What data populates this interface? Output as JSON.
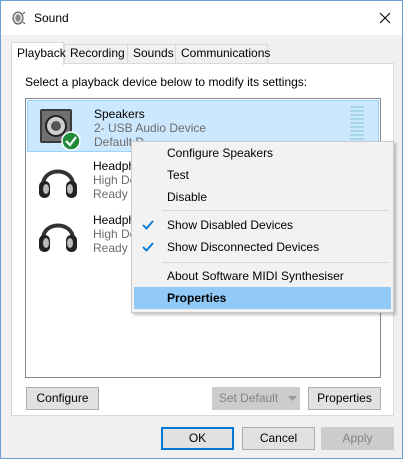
{
  "window": {
    "title": "Sound",
    "close_label": "✕"
  },
  "tabs": [
    {
      "label": "Playback",
      "active": true
    },
    {
      "label": "Recording",
      "active": false
    },
    {
      "label": "Sounds",
      "active": false
    },
    {
      "label": "Communications",
      "active": false
    }
  ],
  "instructions": "Select a playback device below to modify its settings:",
  "devices": [
    {
      "name": "Speakers",
      "description": "2- USB Audio Device",
      "status": "Default D",
      "icon": "speaker-icon",
      "selected": true,
      "default_badge": true
    },
    {
      "name": "Headph",
      "description": "High De",
      "status": "Ready",
      "icon": "headphones-icon",
      "selected": false
    },
    {
      "name": "Headph",
      "description": "High De",
      "status": "Ready",
      "icon": "headphones-icon",
      "selected": false
    }
  ],
  "context_menu": {
    "items": [
      {
        "label": "Configure Speakers",
        "checked": false,
        "bold": false,
        "highlighted": false
      },
      {
        "label": "Test",
        "checked": false,
        "bold": false,
        "highlighted": false
      },
      {
        "label": "Disable",
        "checked": false,
        "bold": false,
        "highlighted": false
      },
      {
        "label": "Show Disabled Devices",
        "checked": true,
        "bold": false,
        "highlighted": false
      },
      {
        "label": "Show Disconnected Devices",
        "checked": true,
        "bold": false,
        "highlighted": false
      },
      {
        "label": "About Software MIDI Synthesiser",
        "checked": false,
        "bold": false,
        "highlighted": false
      },
      {
        "label": "Properties",
        "checked": false,
        "bold": true,
        "highlighted": true
      }
    ]
  },
  "panel_buttons": {
    "configure": "Configure",
    "set_default": "Set Default",
    "properties": "Properties"
  },
  "dialog_buttons": {
    "ok": "OK",
    "cancel": "Cancel",
    "apply": "Apply"
  },
  "colors": {
    "selection": "#cce8ff",
    "menu_highlight": "#91c9f7",
    "accent": "#0078d7",
    "default_badge": "#1e8a3a"
  }
}
